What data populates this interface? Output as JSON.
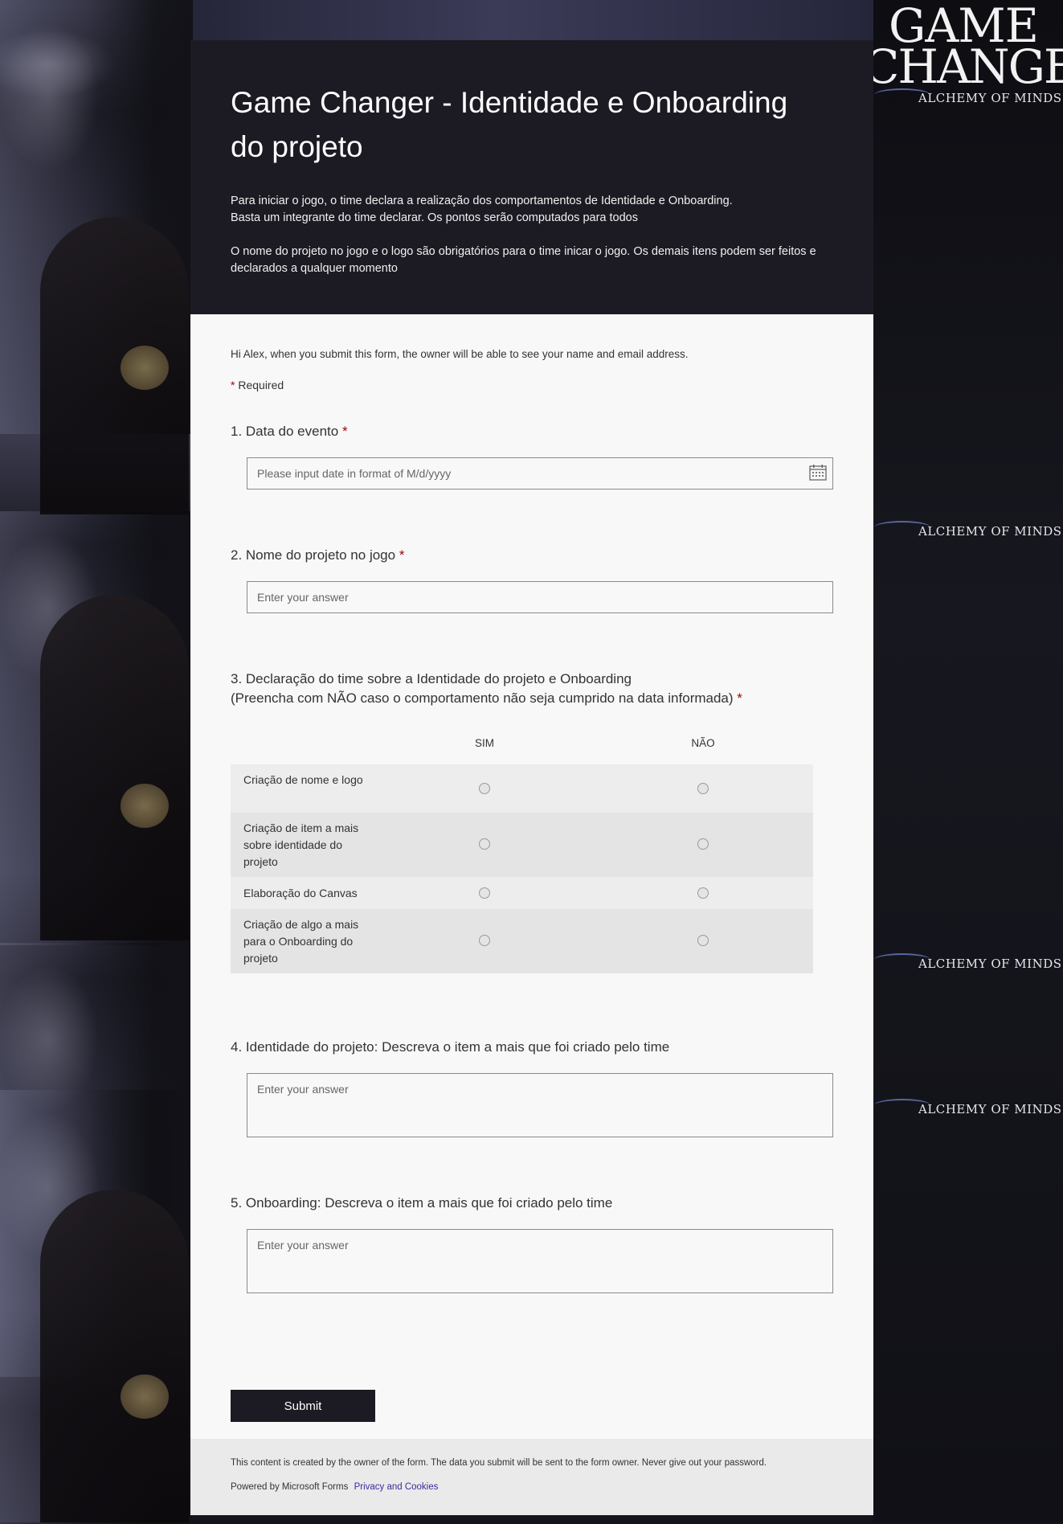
{
  "brand": {
    "logo_line1": "GAME",
    "logo_line2": "CHANGER",
    "logo_tagline": "ALCHEMY OF MINDS"
  },
  "form": {
    "title": "Game Changer - Identidade e Onboarding do projeto",
    "description": [
      "Para iniciar o jogo, o time declara a realização dos comportamentos de Identidade e Onboarding.",
      "Basta um integrante do time declarar. Os pontos serão computados para todos",
      "O nome do projeto no jogo e o logo são obrigatórios para o time inicar o jogo. Os demais itens podem ser feitos e declarados a qualquer momento"
    ],
    "notice": "Hi Alex, when you submit this form, the owner will be able to see your name and email address.",
    "required_label": "Required"
  },
  "questions": {
    "q1": {
      "label": "1. Data do evento",
      "placeholder": "Please input date in format of M/d/yyyy"
    },
    "q2": {
      "label": "2. Nome do projeto no jogo",
      "placeholder": "Enter your answer"
    },
    "q3": {
      "label_line1": "3. Declaração do time sobre a Identidade do projeto e Onboarding",
      "label_line2": "(Preencha com NÃO caso o comportamento não seja cumprido na data informada)",
      "columns": [
        "SIM",
        "NÃO"
      ],
      "rows": [
        "Criação de nome e logo",
        "Criação de item a mais sobre identidade do projeto",
        "Elaboração do Canvas",
        "Criação de algo a mais para o Onboarding do projeto"
      ]
    },
    "q4": {
      "label": "4. Identidade do projeto: Descreva o item a mais que foi criado pelo time",
      "placeholder": "Enter your answer"
    },
    "q5": {
      "label": "5. Onboarding: Descreva o item a mais que foi criado pelo time",
      "placeholder": "Enter your answer"
    }
  },
  "submit_label": "Submit",
  "footer": {
    "disclaimer": "This content is created by the owner of the form. The data you submit will be sent to the form owner. Never give out your password.",
    "powered_by": "Powered by Microsoft Forms",
    "privacy_link": "Privacy and Cookies"
  },
  "colors": {
    "header_bg": "#1c1b24",
    "body_bg": "#f8f8f8",
    "required": "#a80000",
    "link": "#3a2aa0"
  }
}
